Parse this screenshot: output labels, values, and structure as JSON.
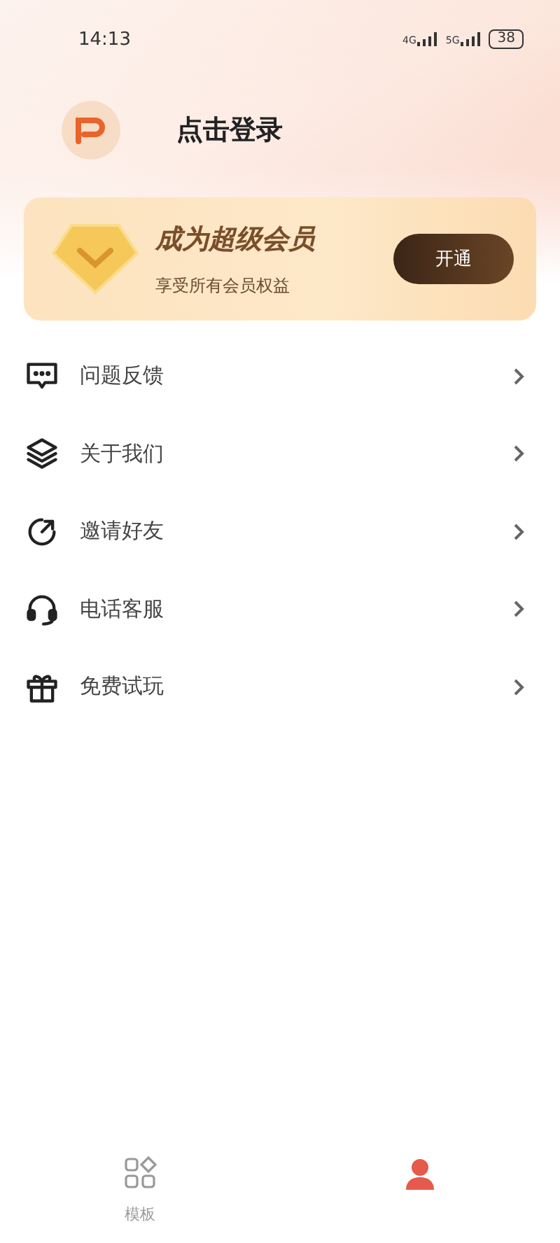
{
  "status_bar": {
    "time": "14:13",
    "network_1": "4G",
    "network_2": "5G",
    "battery": "38"
  },
  "profile": {
    "login_label": "点击登录"
  },
  "vip_card": {
    "title": "成为超级会员",
    "subtitle": "享受所有会员权益",
    "button": "开通"
  },
  "menu": [
    {
      "kind": "feedback",
      "label": "问题反馈"
    },
    {
      "kind": "about",
      "label": "关于我们"
    },
    {
      "kind": "invite",
      "label": "邀请好友"
    },
    {
      "kind": "service",
      "label": "电话客服"
    },
    {
      "kind": "gift",
      "label": "免费试玩"
    }
  ],
  "bottom_nav": [
    {
      "kind": "templates",
      "label": "模板",
      "selected": false
    },
    {
      "kind": "profile",
      "selected": true
    }
  ]
}
